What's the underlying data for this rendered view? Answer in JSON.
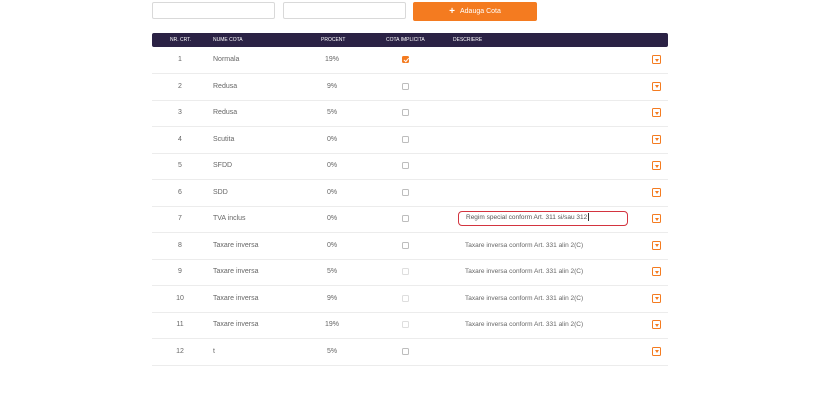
{
  "toolbar": {
    "input1_value": "",
    "input2_value": "",
    "add_button_label": "Adauga Cota",
    "add_icon": "plus-icon"
  },
  "table": {
    "headers": {
      "nr": "NR. CRT.",
      "nume": "NUME COTA",
      "procent": "PROCENT",
      "cota_implicita": "COTA IMPLICITA",
      "descriere": "DESCRIERE"
    },
    "rows": [
      {
        "nr": "1",
        "nume": "Normala",
        "procent": "19%",
        "implicit": true,
        "descriere": ""
      },
      {
        "nr": "2",
        "nume": "Redusa",
        "procent": "9%",
        "implicit": false,
        "descriere": ""
      },
      {
        "nr": "3",
        "nume": "Redusa",
        "procent": "5%",
        "implicit": false,
        "descriere": ""
      },
      {
        "nr": "4",
        "nume": "Scutita",
        "procent": "0%",
        "implicit": false,
        "descriere": ""
      },
      {
        "nr": "5",
        "nume": "SFDD",
        "procent": "0%",
        "implicit": false,
        "descriere": ""
      },
      {
        "nr": "6",
        "nume": "SDD",
        "procent": "0%",
        "implicit": false,
        "descriere": ""
      },
      {
        "nr": "7",
        "nume": "TVA inclus",
        "procent": "0%",
        "implicit": false,
        "descriere": "Regim special conform Art. 311 si/sau 312",
        "editing": true
      },
      {
        "nr": "8",
        "nume": "Taxare inversa",
        "procent": "0%",
        "implicit": false,
        "descriere": "Taxare inversa conform Art. 331 alin 2(C)"
      },
      {
        "nr": "9",
        "nume": "Taxare inversa",
        "procent": "5%",
        "implicit": false,
        "descriere": "Taxare inversa conform Art. 331 alin 2(C)"
      },
      {
        "nr": "10",
        "nume": "Taxare inversa",
        "procent": "9%",
        "implicit": false,
        "descriere": "Taxare inversa conform Art. 331 alin 2(C)"
      },
      {
        "nr": "11",
        "nume": "Taxare inversa",
        "procent": "19%",
        "implicit": false,
        "descriere": "Taxare inversa conform Art. 331 alin 2(C)"
      },
      {
        "nr": "12",
        "nume": "t",
        "procent": "5%",
        "implicit": false,
        "descriere": ""
      }
    ]
  },
  "colors": {
    "accent": "#f47b20",
    "header_bg": "#2b2245",
    "edit_border": "#d3343f"
  }
}
